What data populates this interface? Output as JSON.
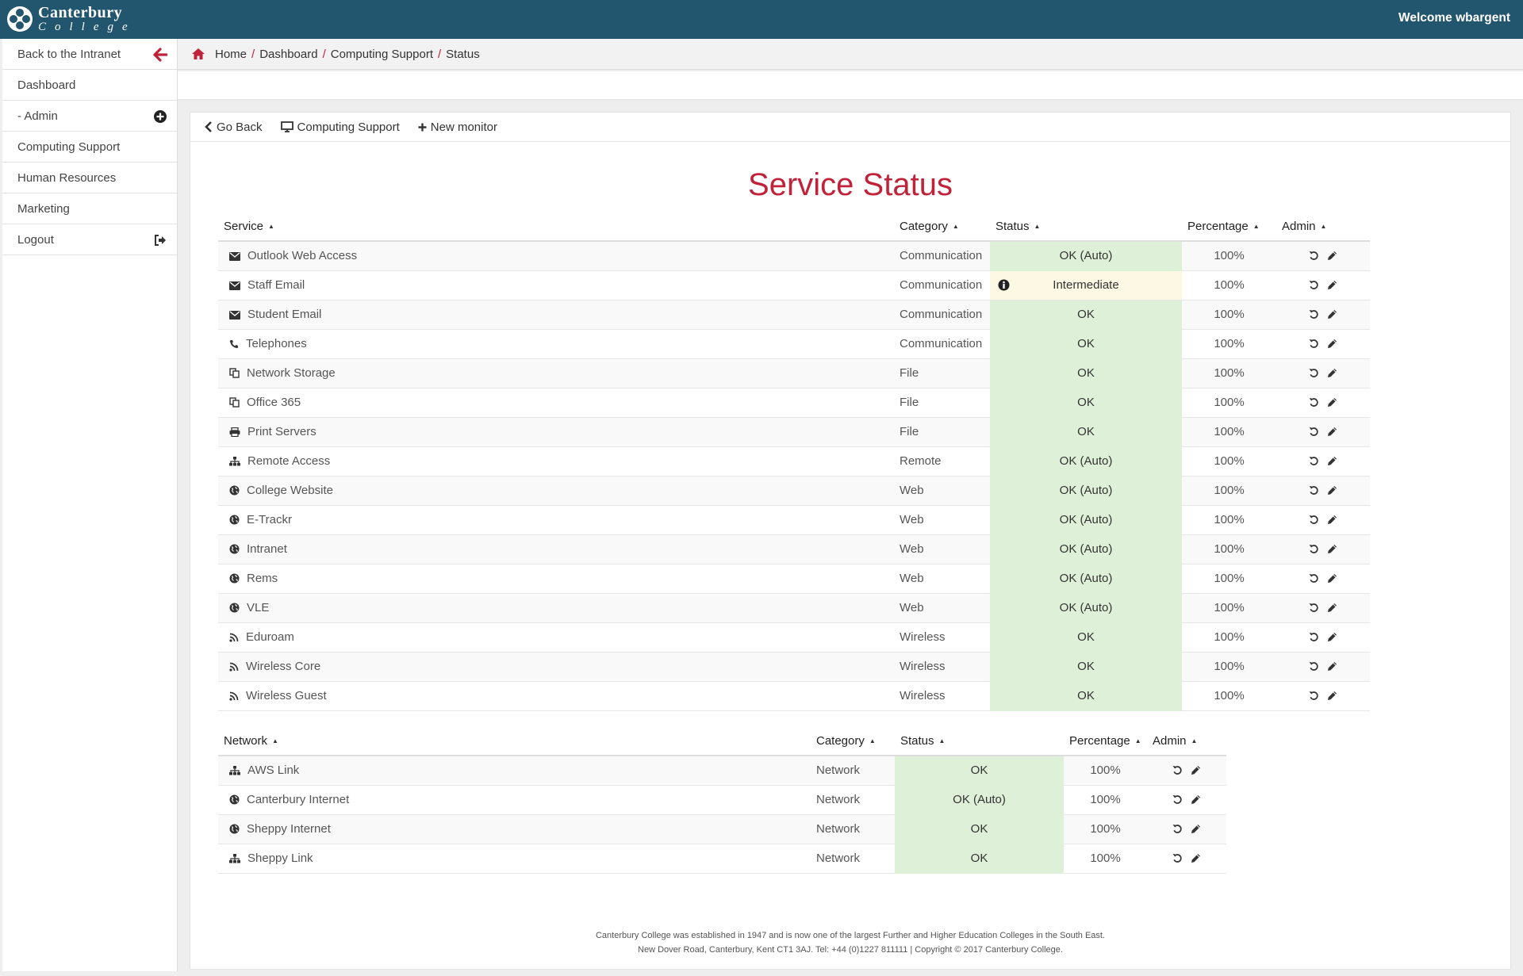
{
  "brand": {
    "line1": "Canterbury",
    "line2": "College"
  },
  "welcome": "Welcome wbargent",
  "sidebar": {
    "items": [
      {
        "label": "Back to the Intranet",
        "icon": "arrow-left-icon"
      },
      {
        "label": "Dashboard"
      },
      {
        "label": "- Admin",
        "icon": "plus-circle-icon"
      },
      {
        "label": "Computing Support"
      },
      {
        "label": "Human Resources"
      },
      {
        "label": "Marketing"
      },
      {
        "label": "Logout",
        "icon": "logout-icon"
      }
    ]
  },
  "breadcrumb": [
    "Home",
    "Dashboard",
    "Computing Support",
    "Status"
  ],
  "toolbar": {
    "go_back": "Go Back",
    "computing_support": "Computing Support",
    "new_monitor": "New monitor"
  },
  "title": "Service Status",
  "services": {
    "headers": [
      "Service",
      "Category",
      "Status",
      "Percentage",
      "Admin"
    ],
    "rows": [
      {
        "icon": "envelope",
        "name": "Outlook Web Access",
        "category": "Communication",
        "status": "OK (Auto)",
        "level": "ok",
        "pct": "100%"
      },
      {
        "icon": "envelope",
        "name": "Staff Email",
        "category": "Communication",
        "status": "Intermediate",
        "level": "warn",
        "pct": "100%"
      },
      {
        "icon": "envelope",
        "name": "Student Email",
        "category": "Communication",
        "status": "OK",
        "level": "ok",
        "pct": "100%"
      },
      {
        "icon": "phone",
        "name": "Telephones",
        "category": "Communication",
        "status": "OK",
        "level": "ok",
        "pct": "100%"
      },
      {
        "icon": "files",
        "name": "Network Storage",
        "category": "File",
        "status": "OK",
        "level": "ok",
        "pct": "100%"
      },
      {
        "icon": "files",
        "name": "Office 365",
        "category": "File",
        "status": "OK",
        "level": "ok",
        "pct": "100%"
      },
      {
        "icon": "printer",
        "name": "Print Servers",
        "category": "File",
        "status": "OK",
        "level": "ok",
        "pct": "100%"
      },
      {
        "icon": "sitemap",
        "name": "Remote Access",
        "category": "Remote",
        "status": "OK (Auto)",
        "level": "ok",
        "pct": "100%"
      },
      {
        "icon": "globe",
        "name": "College Website",
        "category": "Web",
        "status": "OK (Auto)",
        "level": "ok",
        "pct": "100%"
      },
      {
        "icon": "globe",
        "name": "E-Trackr",
        "category": "Web",
        "status": "OK (Auto)",
        "level": "ok",
        "pct": "100%"
      },
      {
        "icon": "globe",
        "name": "Intranet",
        "category": "Web",
        "status": "OK (Auto)",
        "level": "ok",
        "pct": "100%"
      },
      {
        "icon": "globe",
        "name": "Rems",
        "category": "Web",
        "status": "OK (Auto)",
        "level": "ok",
        "pct": "100%"
      },
      {
        "icon": "globe",
        "name": "VLE",
        "category": "Web",
        "status": "OK (Auto)",
        "level": "ok",
        "pct": "100%"
      },
      {
        "icon": "rss",
        "name": "Eduroam",
        "category": "Wireless",
        "status": "OK",
        "level": "ok",
        "pct": "100%"
      },
      {
        "icon": "rss",
        "name": "Wireless Core",
        "category": "Wireless",
        "status": "OK",
        "level": "ok",
        "pct": "100%"
      },
      {
        "icon": "rss",
        "name": "Wireless Guest",
        "category": "Wireless",
        "status": "OK",
        "level": "ok",
        "pct": "100%"
      }
    ]
  },
  "network": {
    "headers": [
      "Network",
      "Category",
      "Status",
      "Percentage",
      "Admin"
    ],
    "rows": [
      {
        "icon": "sitemap",
        "name": "AWS Link",
        "category": "Network",
        "status": "OK",
        "level": "ok",
        "pct": "100%"
      },
      {
        "icon": "globe",
        "name": "Canterbury Internet",
        "category": "Network",
        "status": "OK (Auto)",
        "level": "ok",
        "pct": "100%"
      },
      {
        "icon": "globe",
        "name": "Sheppy Internet",
        "category": "Network",
        "status": "OK",
        "level": "ok",
        "pct": "100%"
      },
      {
        "icon": "sitemap",
        "name": "Sheppy Link",
        "category": "Network",
        "status": "OK",
        "level": "ok",
        "pct": "100%"
      }
    ]
  },
  "footer": {
    "line1": "Canterbury College was established in 1947 and is now one of the largest Further and Higher Education Colleges in the South East.",
    "line2": "New Dover Road, Canterbury, Kent CT1 3AJ. Tel: +44 (0)1227 811111 | Copyright © 2017 Canterbury College."
  },
  "colors": {
    "topbar": "#22566e",
    "accent": "#c0223a",
    "ok": "#dff0d8",
    "warn": "#fcf8e3"
  }
}
